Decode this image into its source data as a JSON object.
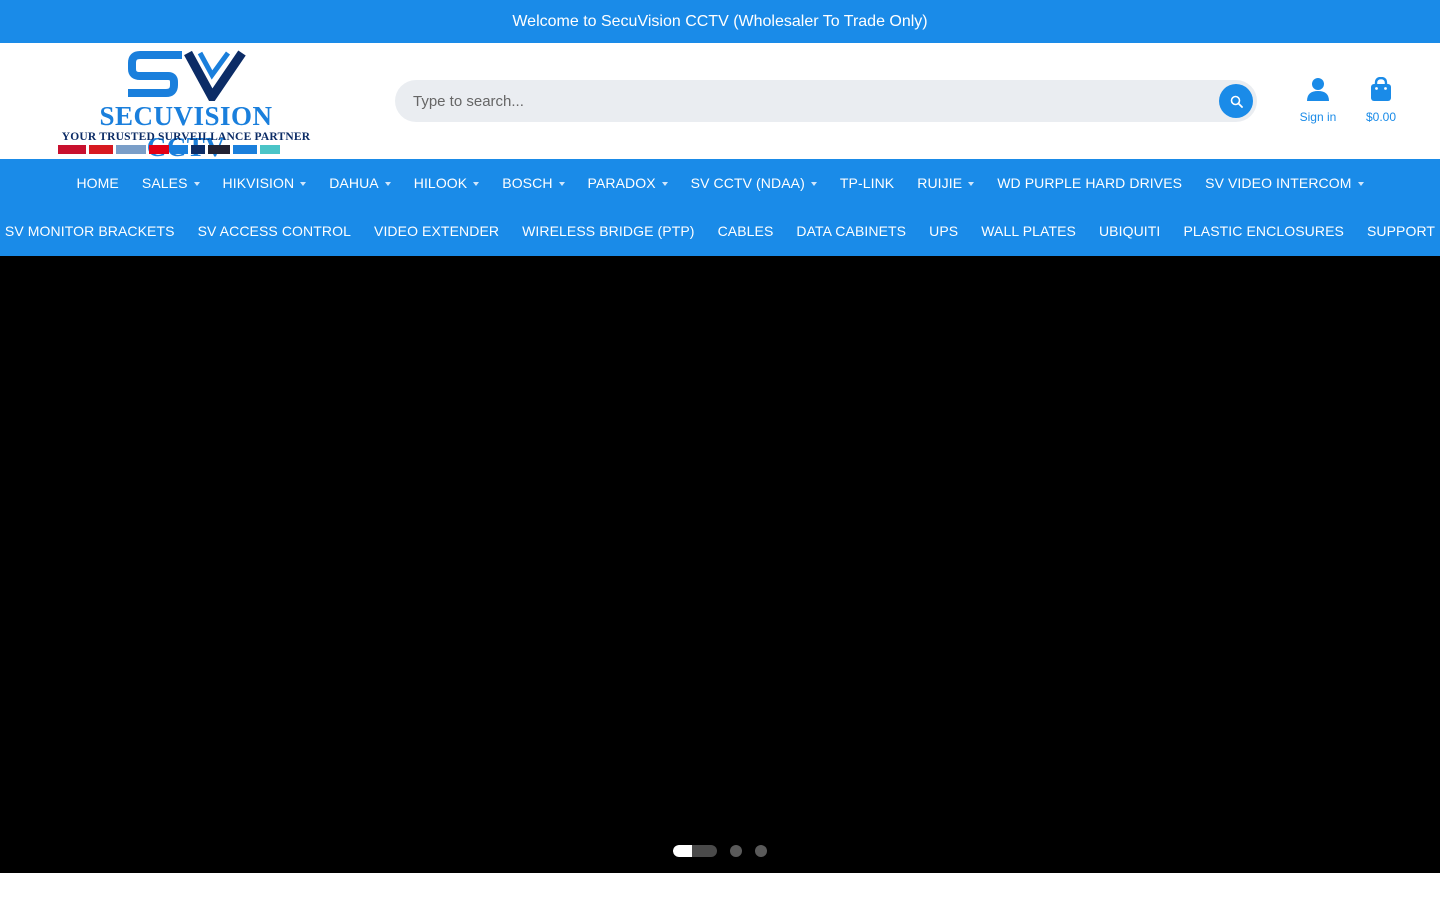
{
  "announcement": "Welcome to SecuVision CCTV (Wholesaler To Trade Only)",
  "logo": {
    "name": "SECUVISION CCTV",
    "tagline": "YOUR TRUSTED SURVEILLANCE PARTNER",
    "brands": [
      "HIKVISION",
      "alhua",
      "HiLook",
      "BOSCH",
      "SV",
      "WD",
      "UBIQUITI"
    ]
  },
  "search": {
    "placeholder": "Type to search..."
  },
  "header_actions": {
    "sign_in": "Sign in",
    "cart_total": "$0.00"
  },
  "nav": {
    "row1": [
      {
        "label": "HOME",
        "dropdown": false
      },
      {
        "label": "SALES",
        "dropdown": true
      },
      {
        "label": "HIKVISION",
        "dropdown": true
      },
      {
        "label": "DAHUA",
        "dropdown": true
      },
      {
        "label": "HILOOK",
        "dropdown": true
      },
      {
        "label": "BOSCH",
        "dropdown": true
      },
      {
        "label": "PARADOX",
        "dropdown": true
      },
      {
        "label": "SV CCTV (NDAA)",
        "dropdown": true
      },
      {
        "label": "TP-LINK",
        "dropdown": false
      },
      {
        "label": "RUIJIE",
        "dropdown": true
      },
      {
        "label": "WD PURPLE HARD DRIVES",
        "dropdown": false
      },
      {
        "label": "SV VIDEO INTERCOM",
        "dropdown": true
      }
    ],
    "row2": [
      {
        "label": "SV MONITOR BRACKETS",
        "dropdown": false
      },
      {
        "label": "SV ACCESS CONTROL",
        "dropdown": false
      },
      {
        "label": "VIDEO EXTENDER",
        "dropdown": false
      },
      {
        "label": "WIRELESS BRIDGE (PTP)",
        "dropdown": false
      },
      {
        "label": "CABLES",
        "dropdown": false
      },
      {
        "label": "DATA CABINETS",
        "dropdown": false
      },
      {
        "label": "UPS",
        "dropdown": false
      },
      {
        "label": "WALL PLATES",
        "dropdown": false
      },
      {
        "label": "UBIQUITI",
        "dropdown": false
      },
      {
        "label": "PLASTIC ENCLOSURES",
        "dropdown": false
      },
      {
        "label": "SUPPORT",
        "dropdown": false
      }
    ]
  },
  "slideshow": {
    "slide_count": 3,
    "active_index": 0,
    "active_progress": 0.43
  },
  "colors": {
    "brand_blue": "#1a8be8",
    "hero_bg": "#000000"
  }
}
